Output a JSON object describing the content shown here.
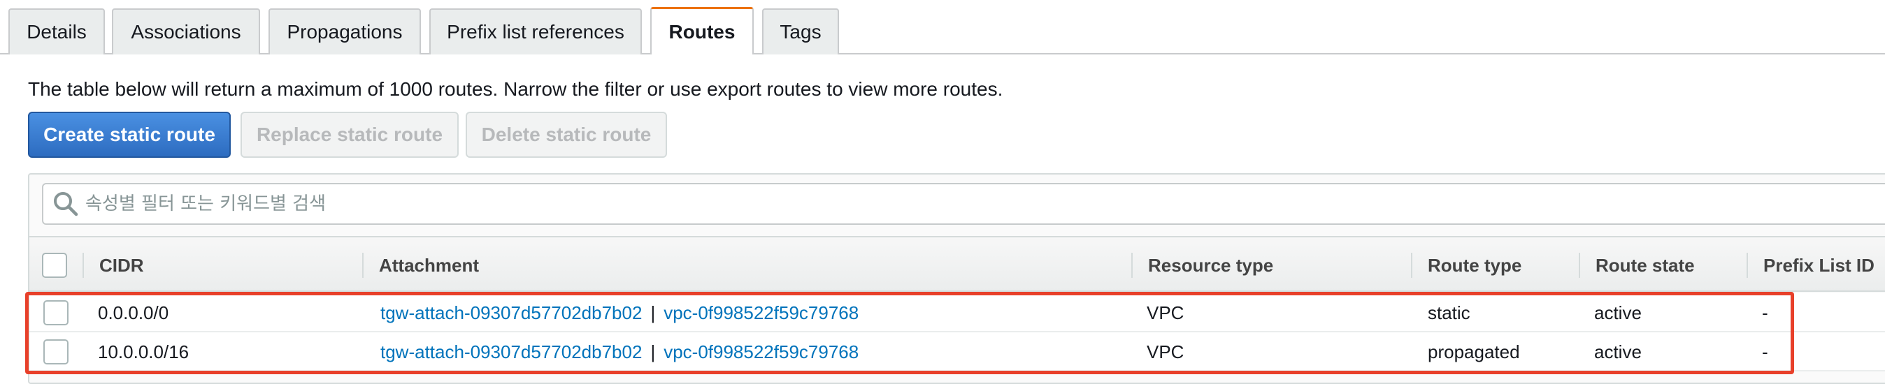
{
  "tabs": [
    {
      "label": "Details"
    },
    {
      "label": "Associations"
    },
    {
      "label": "Propagations"
    },
    {
      "label": "Prefix list references"
    },
    {
      "label": "Routes"
    },
    {
      "label": "Tags"
    }
  ],
  "active_tab": "Routes",
  "info_text": "The table below will return a maximum of 1000 routes. Narrow the filter or use export routes to view more routes.",
  "buttons": {
    "create": "Create static route",
    "replace": "Replace static route",
    "delete": "Delete static route"
  },
  "search": {
    "placeholder": "속성별 필터 또는 키워드별 검색",
    "value": ""
  },
  "table": {
    "headers": {
      "cidr": "CIDR",
      "attachment": "Attachment",
      "resource_type": "Resource type",
      "route_type": "Route type",
      "route_state": "Route state",
      "prefix_list_id": "Prefix List ID"
    },
    "rows": [
      {
        "cidr": "0.0.0.0/0",
        "attachment_id": "tgw-attach-09307d57702db7b02",
        "separator": "|",
        "vpc_id": "vpc-0f998522f59c79768",
        "resource_type": "VPC",
        "route_type": "static",
        "route_state": "active",
        "prefix_list_id": "-"
      },
      {
        "cidr": "10.0.0.0/16",
        "attachment_id": "tgw-attach-09307d57702db7b02",
        "separator": "|",
        "vpc_id": "vpc-0f998522f59c79768",
        "resource_type": "VPC",
        "route_type": "propagated",
        "route_state": "active",
        "prefix_list_id": "-"
      }
    ]
  },
  "colors": {
    "accent_tab": "#ec7211",
    "primary_button": "#2d6cc0",
    "link": "#0073bb",
    "highlight": "#e8402a"
  }
}
